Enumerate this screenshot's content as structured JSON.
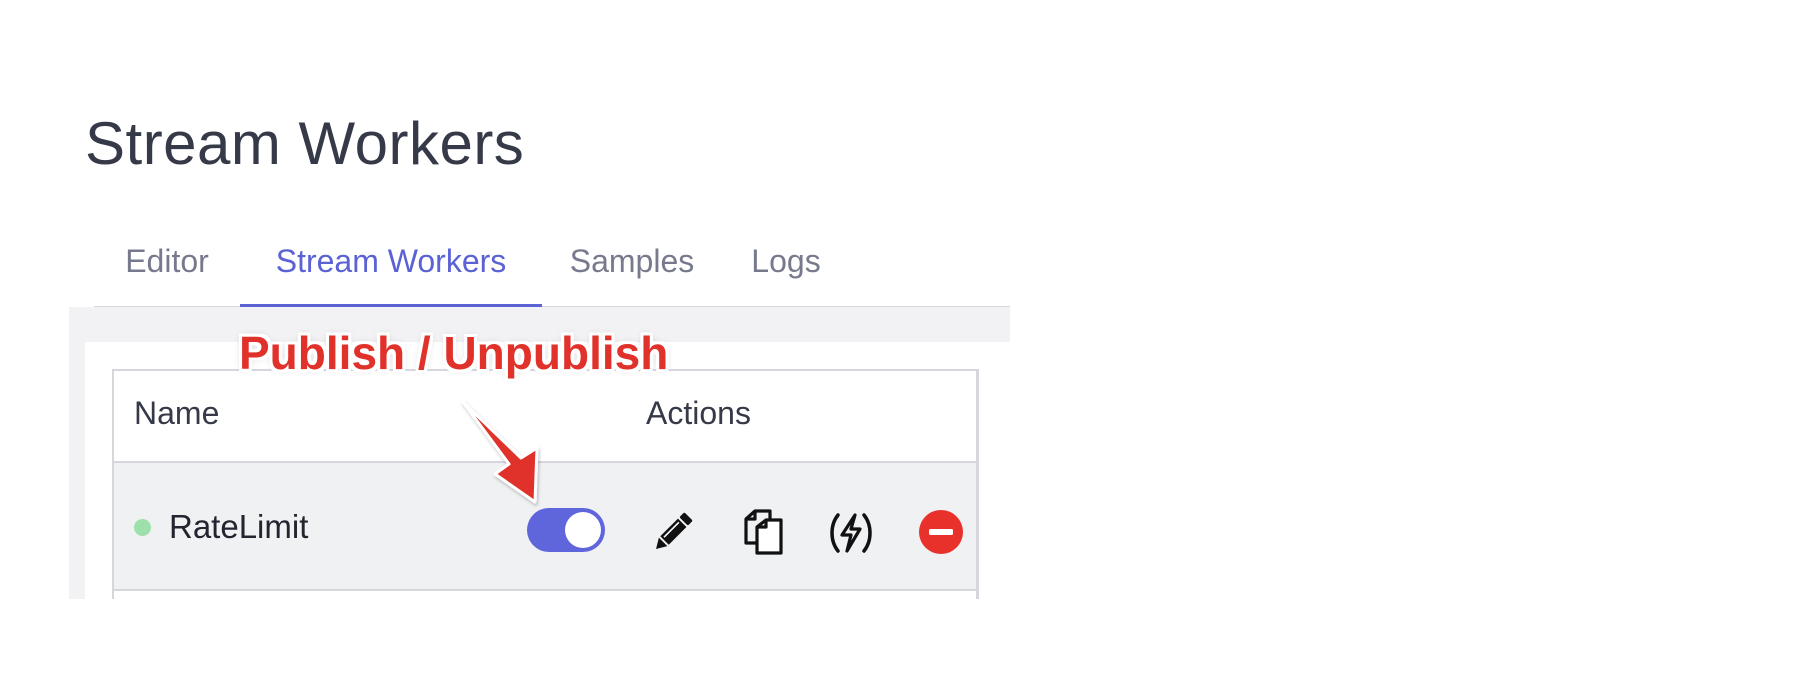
{
  "page": {
    "title": "Stream Workers"
  },
  "tabs": [
    {
      "label": "Editor",
      "active": false
    },
    {
      "label": "Stream Workers",
      "active": true
    },
    {
      "label": "Samples",
      "active": false
    },
    {
      "label": "Logs",
      "active": false
    }
  ],
  "table": {
    "headers": {
      "name": "Name",
      "actions": "Actions"
    },
    "rows": [
      {
        "status_color": "#9ee0ac",
        "name": "RateLimit",
        "published": true,
        "actions": [
          "pencil-icon",
          "copy-icon",
          "lightning-icon",
          "remove-icon"
        ]
      }
    ]
  },
  "annotation": {
    "label": "Publish / Unpublish",
    "color": "#e0312a"
  },
  "colors": {
    "accent": "#5b62d4",
    "toggle_on": "#5f66dc",
    "delete": "#e8312b",
    "status_active": "#9ee0ac"
  }
}
